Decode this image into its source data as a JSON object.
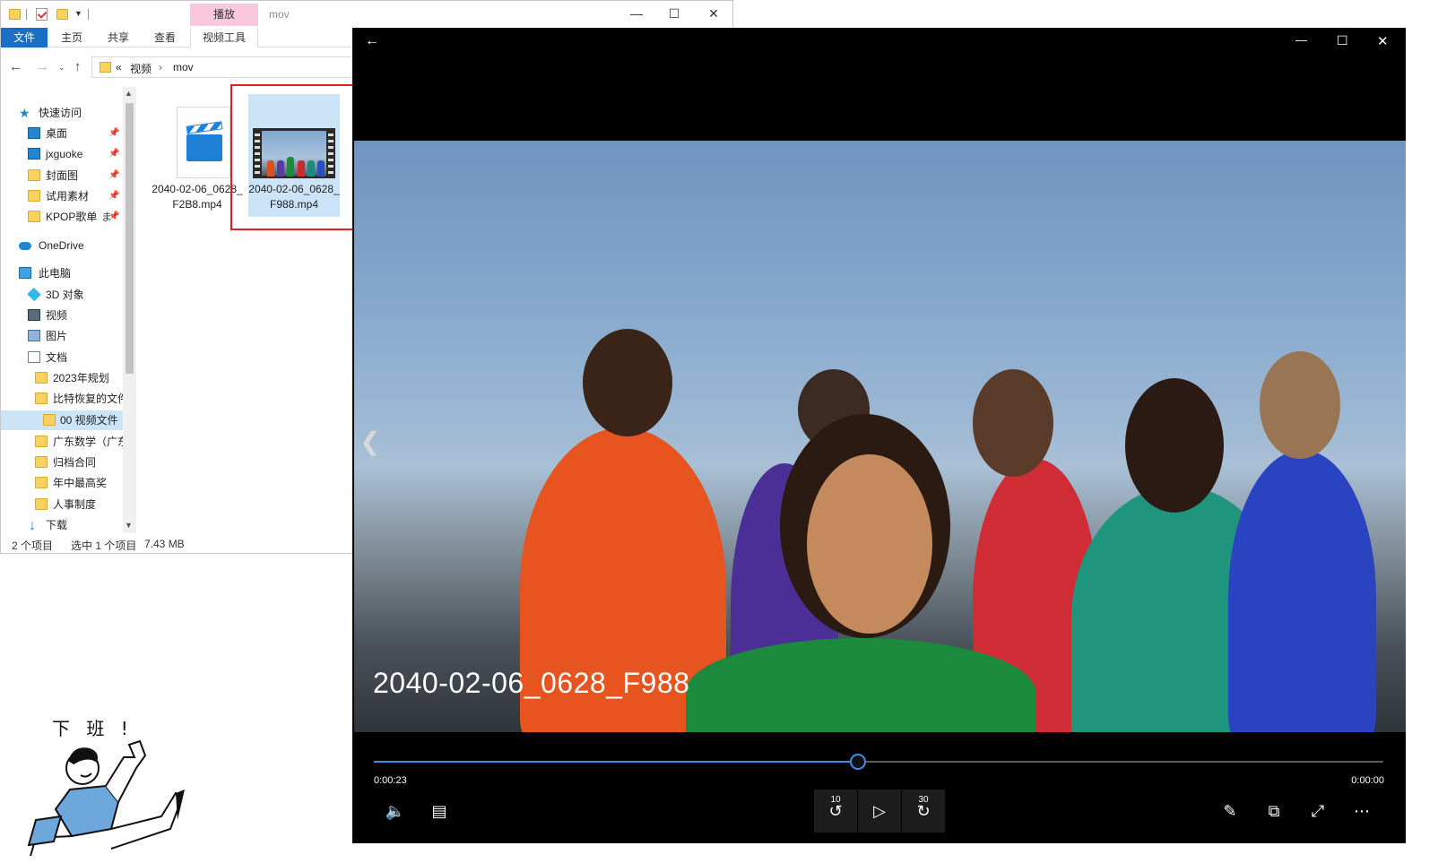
{
  "explorer": {
    "context_tab": "播放",
    "window_title": "mov",
    "ribbon_tabs": [
      "文件",
      "主页",
      "共享",
      "查看",
      "视频工具"
    ],
    "breadcrumb": {
      "prefix": "«",
      "items": [
        "视频",
        "mov"
      ]
    },
    "nav": {
      "quick_access": "快速访问",
      "pinned": [
        "桌面",
        "jxguoke",
        "封面图",
        "试用素材",
        "KPOP歌单"
      ],
      "pinned_extra": "ま",
      "onedrive": "OneDrive",
      "this_pc": "此电脑",
      "pc_items": [
        "3D 对象",
        "视频",
        "图片",
        "文档"
      ],
      "doc_folders": [
        "2023年规划",
        "比特恢复的文件",
        "00 视频文件",
        "广东数学（广东",
        "归档合同",
        "年中最高奖",
        "人事制度"
      ],
      "downloads": "下载"
    },
    "files": [
      {
        "name": "2040-02-06_0628_F2B8.mp4"
      },
      {
        "name": "2040-02-06_0628_F988.mp4"
      }
    ],
    "status": {
      "count": "2 个项目",
      "selected": "选中 1 个项目",
      "size": "7.43 MB"
    }
  },
  "cartoon": {
    "text": "下 班 !"
  },
  "player": {
    "video_title": "2040-02-06_0628_F988",
    "time_elapsed": "0:00:23",
    "time_remaining": "0:00:00",
    "progress": 0.48,
    "skip_back": "10",
    "skip_forward": "30",
    "colors": {
      "accent": "#3d8ee0",
      "background": "#000000"
    }
  },
  "icons": [
    "back-arrow-icon",
    "minimize-icon",
    "maximize-icon",
    "close-icon",
    "volume-icon",
    "captions-icon",
    "rewind-10-icon",
    "play-icon",
    "forward-30-icon",
    "pen-icon",
    "mini-view-icon",
    "fullscreen-icon",
    "more-icon"
  ]
}
